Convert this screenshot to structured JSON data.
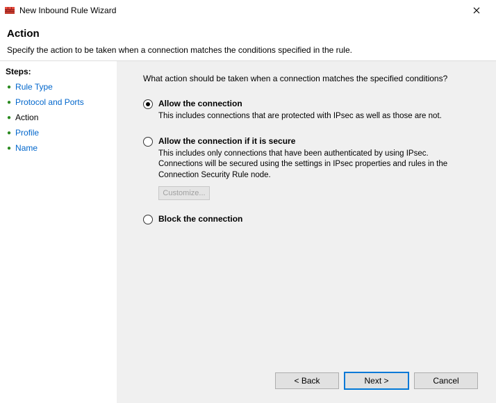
{
  "titlebar": {
    "title": "New Inbound Rule Wizard"
  },
  "header": {
    "title": "Action",
    "subtitle": "Specify the action to be taken when a connection matches the conditions specified in the rule."
  },
  "steps": {
    "title": "Steps:",
    "items": [
      {
        "label": "Rule Type",
        "current": false
      },
      {
        "label": "Protocol and Ports",
        "current": false
      },
      {
        "label": "Action",
        "current": true
      },
      {
        "label": "Profile",
        "current": false
      },
      {
        "label": "Name",
        "current": false
      }
    ]
  },
  "content": {
    "prompt": "What action should be taken when a connection matches the specified conditions?",
    "options": {
      "allow": {
        "label": "Allow the connection",
        "desc": "This includes connections that are protected with IPsec as well as those are not.",
        "selected": true
      },
      "allow_secure": {
        "label": "Allow the connection if it is secure",
        "desc": "This includes only connections that have been authenticated by using IPsec.  Connections will be secured using the settings in IPsec properties and rules in the Connection Security Rule node.",
        "selected": false,
        "customize_label": "Customize..."
      },
      "block": {
        "label": "Block the connection",
        "selected": false
      }
    }
  },
  "buttons": {
    "back": "< Back",
    "next": "Next >",
    "cancel": "Cancel"
  }
}
